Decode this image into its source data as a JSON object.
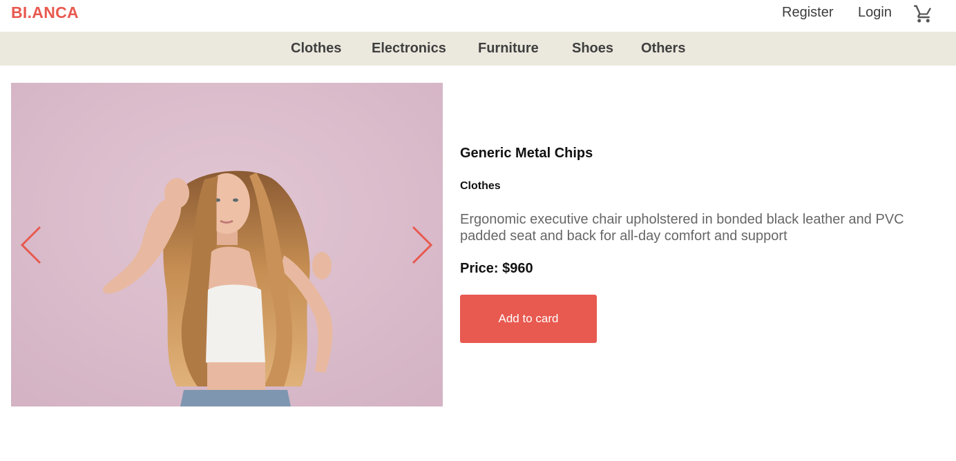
{
  "header": {
    "logo": "BI.ANCA",
    "register_label": "Register",
    "login_label": "Login",
    "cart_icon": "cart-icon"
  },
  "categories": [
    "Clothes",
    "Electronics",
    "Furniture",
    "Shoes",
    "Others"
  ],
  "slider": {
    "image": "woman-with-long-wavy-hair-photo",
    "prev_icon": "chevron-left-icon",
    "next_icon": "chevron-right-icon"
  },
  "product": {
    "title": "Generic Metal Chips",
    "category": "Clothes",
    "description": "Ergonomic executive chair upholstered in bonded black leather and PVC padded seat and back for all-day comfort and support",
    "price": "Price: $960",
    "add_button_label": "Add to card"
  },
  "colors": {
    "accent": "#e8594f",
    "category_bar": "#ebe8dd",
    "photo_background": "#d8bccb"
  }
}
